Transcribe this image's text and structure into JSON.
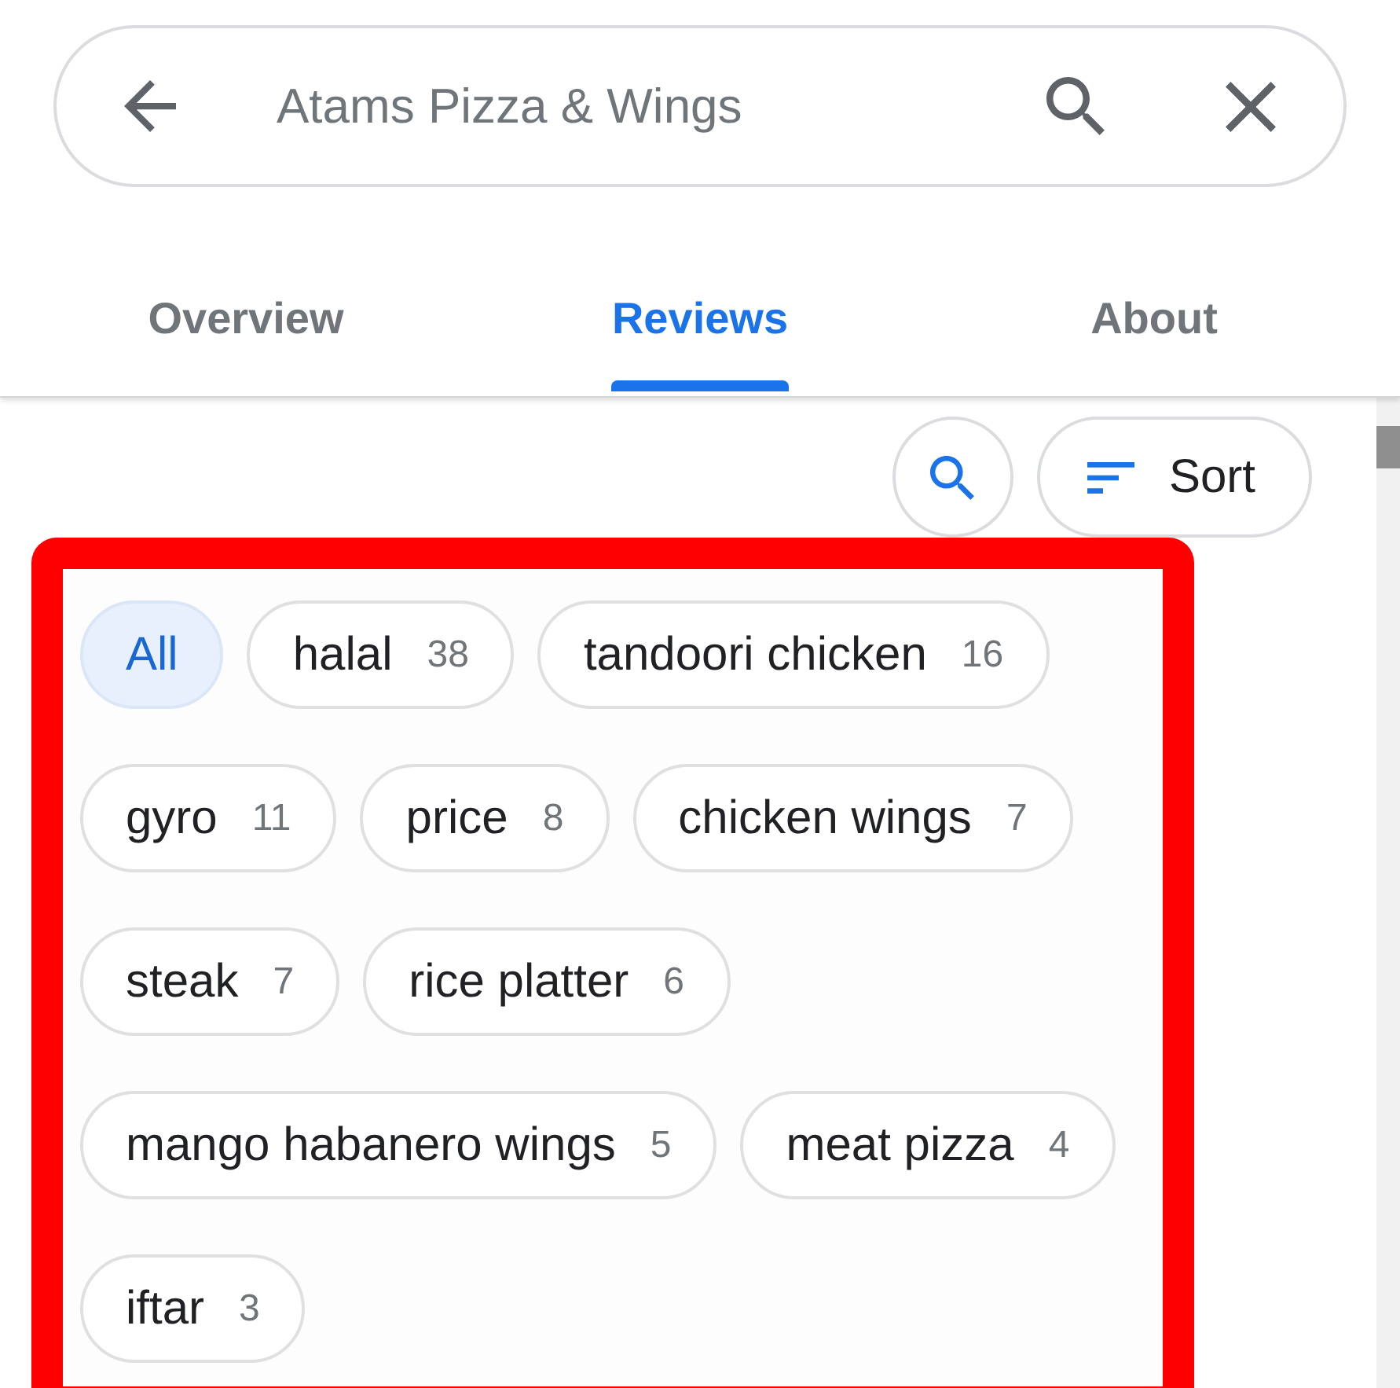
{
  "search_bar": {
    "value": "Atams Pizza & Wings"
  },
  "tabs": [
    {
      "label": "Overview",
      "selected": false
    },
    {
      "label": "Reviews",
      "selected": true
    },
    {
      "label": "About",
      "selected": false
    }
  ],
  "toolbar": {
    "sort_button": {
      "label": "Sort"
    }
  },
  "topic_chips": [
    {
      "label": "All",
      "selected": true
    },
    {
      "label": "halal",
      "count": "38",
      "selected": false
    },
    {
      "label": "tandoori chicken",
      "count": "16",
      "selected": false
    },
    {
      "label": "gyro",
      "count": "11",
      "selected": false
    },
    {
      "label": "price",
      "count": "8",
      "selected": false
    },
    {
      "label": "chicken wings",
      "count": "7",
      "selected": false
    },
    {
      "label": "steak",
      "count": "7",
      "selected": false
    },
    {
      "label": "rice platter",
      "count": "6",
      "selected": false
    },
    {
      "label": "mango habanero wings",
      "count": "5",
      "selected": false
    },
    {
      "label": "meat pizza",
      "count": "4",
      "selected": false
    },
    {
      "label": "iftar",
      "count": "3",
      "selected": false
    }
  ]
}
